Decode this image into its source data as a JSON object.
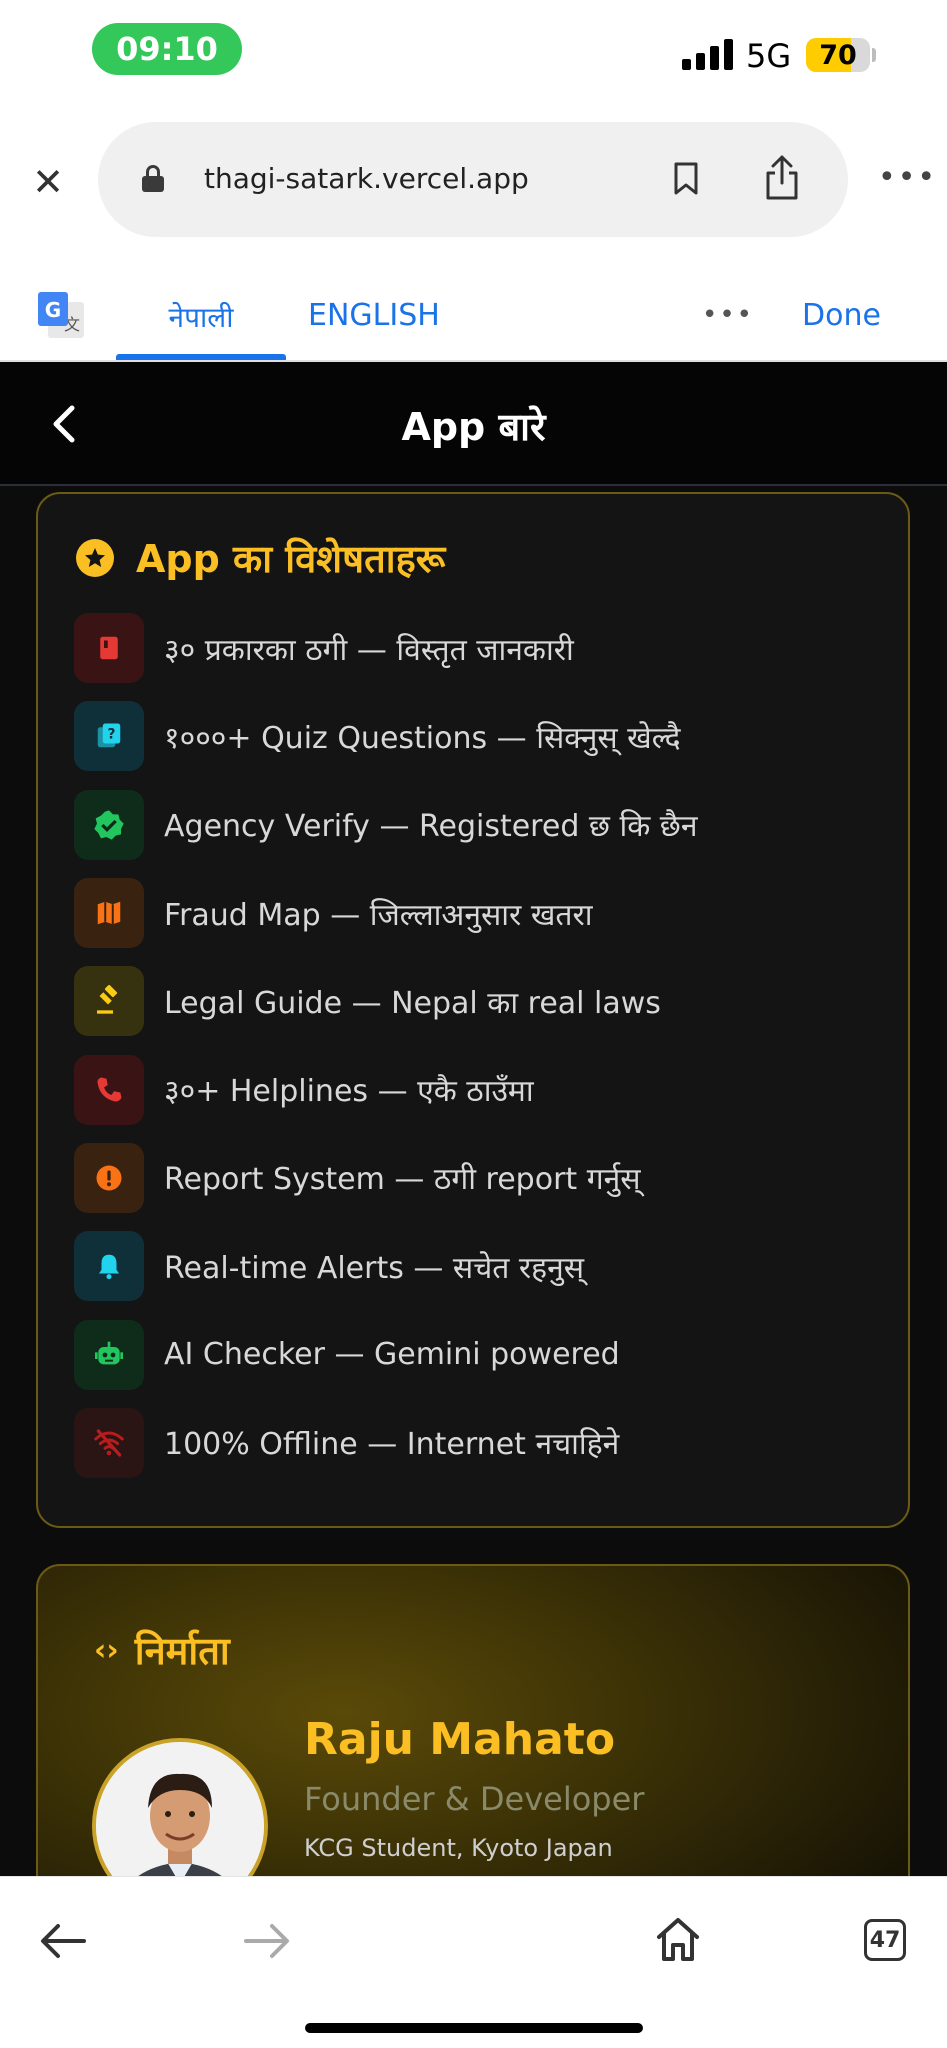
{
  "status_bar": {
    "time": "09:10",
    "network": "5G",
    "battery_level": "70",
    "battery_fraction": 0.7,
    "time_pill_color": "#34c759",
    "battery_color": "#ffcc00"
  },
  "browser": {
    "url": "thagi-satark.vercel.app",
    "close_icon": "close-icon",
    "lock_icon": "lock-icon",
    "bookmark_icon": "bookmark-icon",
    "share_icon": "share-icon",
    "more_icon": "more-dots-icon"
  },
  "translate_bar": {
    "tab_nepali": "नेपाली",
    "tab_english": "ENGLISH",
    "more": "•••",
    "done": "Done",
    "accent": "#1a73e8"
  },
  "app": {
    "header_title": "App बारे",
    "features": {
      "title": "App का विशेषताहरू",
      "items": [
        {
          "text": "३० प्रकारका ठगी — विस्तृत जानकारी",
          "icon": "book-icon",
          "bg": "#3a1414",
          "fg": "#e53935"
        },
        {
          "text": "१०००+ Quiz Questions — सिक्नुस् खेल्दै",
          "icon": "quiz-icon",
          "bg": "#0f3038",
          "fg": "#22d3ee"
        },
        {
          "text": "Agency Verify — Registered छ कि छैन",
          "icon": "verified-icon",
          "bg": "#0f2c1a",
          "fg": "#22c55e"
        },
        {
          "text": "Fraud Map — जिल्लाअनुसार खतरा",
          "icon": "map-icon",
          "bg": "#3a2210",
          "fg": "#f97316"
        },
        {
          "text": "Legal Guide — Nepal का real laws",
          "icon": "gavel-icon",
          "bg": "#36310f",
          "fg": "#facc15"
        },
        {
          "text": "३०+ Helplines — एकै ठाउँमा",
          "icon": "phone-icon",
          "bg": "#3a1414",
          "fg": "#e53935"
        },
        {
          "text": "Report System — ठगी report गर्नुस्",
          "icon": "alert-circle-icon",
          "bg": "#3a2210",
          "fg": "#f97316"
        },
        {
          "text": "Real-time Alerts — सचेत रहनुस्",
          "icon": "bell-icon",
          "bg": "#0f3038",
          "fg": "#22d3ee"
        },
        {
          "text": "AI Checker — Gemini powered",
          "icon": "robot-icon",
          "bg": "#0f2c1a",
          "fg": "#22c55e"
        },
        {
          "text": "100% Offline — Internet नचाहिने",
          "icon": "wifi-off-icon",
          "bg": "#2a1414",
          "fg": "#b91c1c"
        }
      ]
    },
    "developer": {
      "title": "निर्माता",
      "name": "Raju Mahato",
      "role": "Founder & Developer",
      "school": "KCG Student, Kyoto Japan"
    }
  },
  "bottom_bar": {
    "tab_count": "47"
  }
}
